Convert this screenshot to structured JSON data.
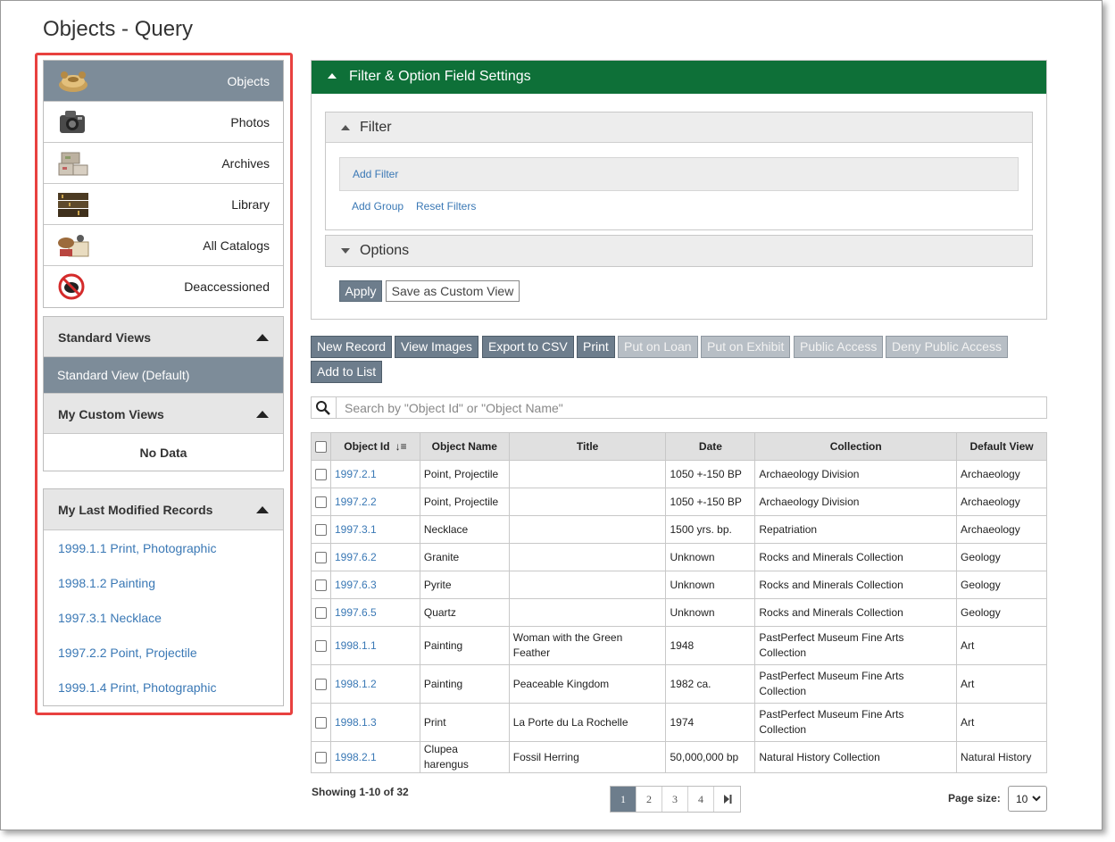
{
  "page": {
    "title": "Objects - Query"
  },
  "catalogs": [
    {
      "label": "Objects",
      "icon": "objects-catalog-icon",
      "active": true
    },
    {
      "label": "Photos",
      "icon": "camera-icon"
    },
    {
      "label": "Archives",
      "icon": "archive-boxes-icon"
    },
    {
      "label": "Library",
      "icon": "books-icon"
    },
    {
      "label": "All Catalogs",
      "icon": "all-catalogs-icon"
    },
    {
      "label": "Deaccessioned",
      "icon": "deaccessioned-icon"
    }
  ],
  "views": {
    "standard_title": "Standard Views",
    "standard_item": "Standard View (Default)",
    "custom_title": "My Custom Views",
    "custom_empty": "No Data"
  },
  "recent": {
    "title": "My Last Modified Records",
    "items": [
      "1999.1.1 Print, Photographic",
      "1998.1.2 Painting",
      "1997.3.1 Necklace",
      "1997.2.2 Point, Projectile",
      "1999.1.4 Print, Photographic"
    ]
  },
  "filter": {
    "header": "Filter & Option Field Settings",
    "filter_title": "Filter",
    "add_filter": "Add Filter",
    "add_group": "Add Group",
    "reset_filters": "Reset Filters",
    "options_title": "Options",
    "apply": "Apply",
    "save_custom_view": "Save as Custom View"
  },
  "actions": {
    "new_record": "New Record",
    "view_images": "View Images",
    "export_csv": "Export to CSV",
    "print": "Print",
    "put_on_loan": "Put on Loan",
    "put_on_exhibit": "Put on Exhibit",
    "public_access": "Public Access",
    "deny_public_access": "Deny Public Access",
    "add_to_list": "Add to List"
  },
  "search": {
    "placeholder": "Search by \"Object Id\" or \"Object Name\""
  },
  "table": {
    "headers": [
      "Object Id",
      "Object Name",
      "Title",
      "Date",
      "Collection",
      "Default View"
    ],
    "rows": [
      {
        "id": "1997.2.1",
        "name": "Point, Projectile",
        "title": "",
        "date": "1050 +-150 BP",
        "collection": "Archaeology Division",
        "view": "Archaeology"
      },
      {
        "id": "1997.2.2",
        "name": "Point, Projectile",
        "title": "",
        "date": "1050 +-150 BP",
        "collection": "Archaeology Division",
        "view": "Archaeology"
      },
      {
        "id": "1997.3.1",
        "name": "Necklace",
        "title": "",
        "date": "1500 yrs. bp.",
        "collection": "Repatriation",
        "view": "Archaeology"
      },
      {
        "id": "1997.6.2",
        "name": "Granite",
        "title": "",
        "date": "Unknown",
        "collection": "Rocks and Minerals Collection",
        "view": "Geology"
      },
      {
        "id": "1997.6.3",
        "name": "Pyrite",
        "title": "",
        "date": "Unknown",
        "collection": "Rocks and Minerals Collection",
        "view": "Geology"
      },
      {
        "id": "1997.6.5",
        "name": "Quartz",
        "title": "",
        "date": "Unknown",
        "collection": "Rocks and Minerals Collection",
        "view": "Geology"
      },
      {
        "id": "1998.1.1",
        "name": "Painting",
        "title": "Woman with the Green Feather",
        "date": "1948",
        "collection": "PastPerfect Museum Fine Arts Collection",
        "view": "Art"
      },
      {
        "id": "1998.1.2",
        "name": "Painting",
        "title": "Peaceable Kingdom",
        "date": "1982 ca.",
        "collection": "PastPerfect Museum Fine Arts Collection",
        "view": "Art"
      },
      {
        "id": "1998.1.3",
        "name": "Print",
        "title": "La Porte du La Rochelle",
        "date": "1974",
        "collection": "PastPerfect Museum Fine Arts Collection",
        "view": "Art"
      },
      {
        "id": "1998.2.1",
        "name": "Clupea harengus",
        "title": "Fossil Herring",
        "date": "50,000,000 bp",
        "collection": "Natural History Collection",
        "view": "Natural History"
      }
    ]
  },
  "footer": {
    "showing": "Showing 1-10 of 32",
    "pages": [
      "1",
      "2",
      "3",
      "4"
    ],
    "current_page": "1",
    "page_size_label": "Page size:",
    "page_size": "10"
  },
  "colors": {
    "header_green": "#0e7038",
    "active_slate": "#7d8c99",
    "link_blue": "#3a78b5",
    "highlight_red": "#e8413f"
  }
}
